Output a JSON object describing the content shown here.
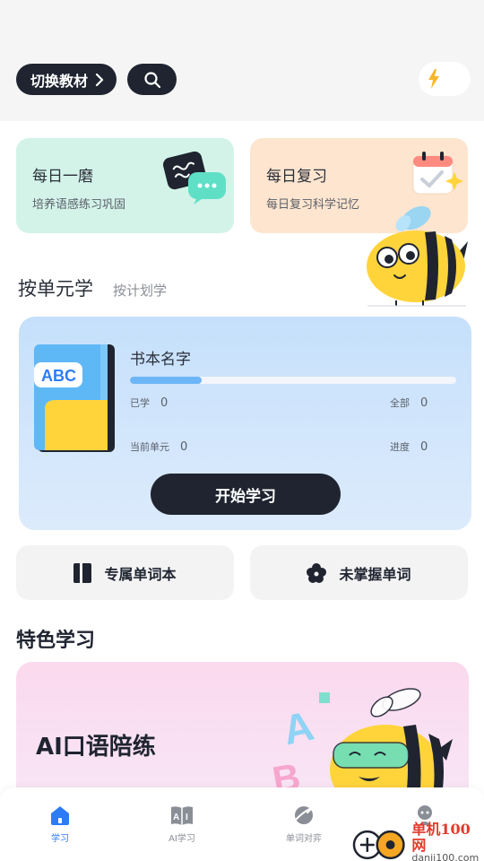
{
  "header": {
    "switch_label": "切换教材",
    "icons": {
      "search": "search-icon",
      "energy": "lightning-icon",
      "chevron": "chevron-right-icon"
    }
  },
  "quick_cards": [
    {
      "title": "每日一磨",
      "subtitle": "培养语感练习巩固",
      "icon": "chat-bubbles-icon",
      "color": "#d3f3e8"
    },
    {
      "title": "每日复习",
      "subtitle": "每日复习科学记忆",
      "icon": "calendar-check-icon",
      "color": "#fde5cf"
    }
  ],
  "mode_tabs": {
    "active": "按单元学",
    "inactive": "按计划学"
  },
  "book": {
    "cover_text": "ABC",
    "name": "书本名字",
    "progress_fraction": 0.22,
    "learned_label": "已学",
    "learned_value": "0",
    "total_label": "全部",
    "total_value": "0",
    "unit_label": "当前单元",
    "unit_value": "0",
    "progress_label": "进度",
    "progress_value": "0",
    "start_label": "开始学习"
  },
  "actions": [
    {
      "label": "专属单词本",
      "icon": "notebook-icon"
    },
    {
      "label": "未掌握单词",
      "icon": "flower-icon"
    }
  ],
  "featured": {
    "section_title": "特色学习",
    "card_title": "AI口语陪练",
    "art_letters": "ABC"
  },
  "bottom_nav": [
    {
      "label": "学习",
      "icon": "home-icon",
      "active": true
    },
    {
      "label": "AI学习",
      "icon": "ai-book-icon",
      "active": false
    },
    {
      "label": "单词对弈",
      "icon": "planet-icon",
      "active": false
    },
    {
      "label": "",
      "icon": "profile-icon",
      "active": false
    }
  ],
  "watermark": {
    "main": "单机100网",
    "sub": "danji100.com"
  },
  "colors": {
    "dark": "#1f2430",
    "accent_blue": "#2d7cf6",
    "progress": "#6cb6f7",
    "bee_yellow": "#ffd43b"
  }
}
